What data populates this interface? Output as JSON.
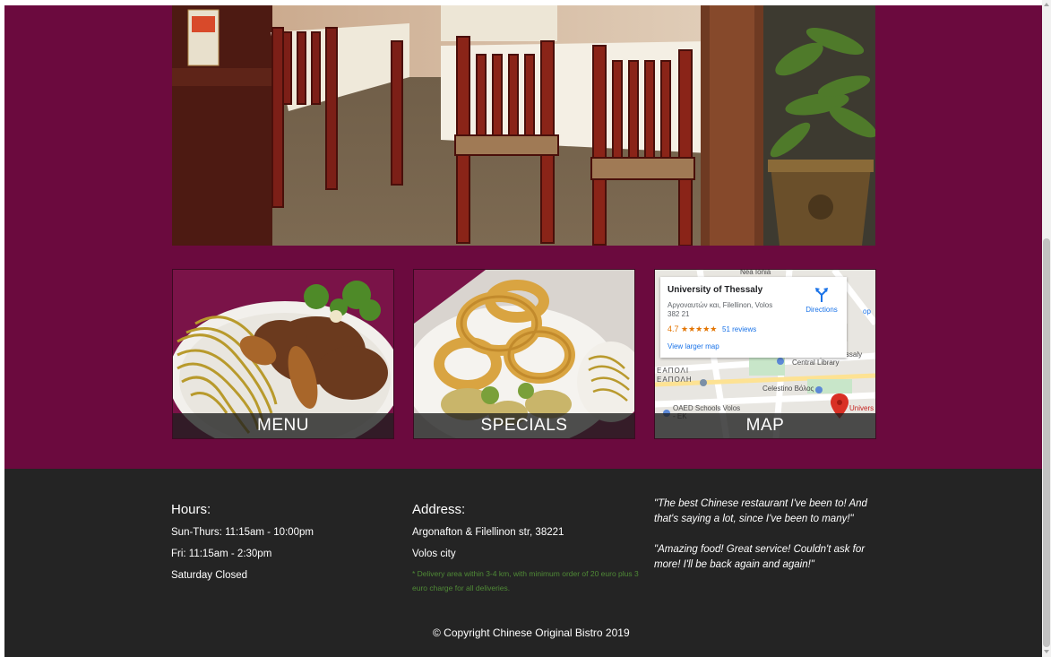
{
  "cards": [
    {
      "label": "MENU"
    },
    {
      "label": "SPECIALS"
    },
    {
      "label": "MAP"
    }
  ],
  "map": {
    "place_name": "University of Thessaly",
    "place_address": "Αργοναυτών και, Filellinon, Volos 382 21",
    "rating": "4.7 ★★★★★",
    "reviews": "51 reviews",
    "directions": "Directions",
    "larger_map": "View larger map",
    "labels": {
      "library": "University of Thessaly Central Library",
      "cafe": "Celestino Βόλος",
      "schools": "OAED Schools Volos - EK",
      "district1": "ΕΑΠΟΛΙ",
      "district2": "ΕΑΠΟΛΗ",
      "pin_label": "Univers",
      "top_label": "Nea Ionia",
      "shop": "op"
    }
  },
  "footer": {
    "hours": {
      "heading": "Hours:",
      "lines": [
        "Sun-Thurs: 11:15am - 10:00pm",
        "Fri: 11:15am - 2:30pm",
        "Saturday Closed"
      ]
    },
    "address": {
      "heading": "Address:",
      "line1": "Argonafton & Filellinon str, 38221",
      "line2": "Volos city",
      "note": "* Delivery area within 3-4 km, with minimum order of 20 euro plus 3 euro charge for all deliveries."
    },
    "quotes": [
      "\"The best Chinese restaurant I've been to! And that's saying a lot, since I've been to many!\"",
      "\"Amazing food! Great service! Couldn't ask for more! I'll be back again and again!\""
    ],
    "copyright": "© Copyright Chinese Original Bistro 2019"
  },
  "colors": {
    "band": "#6b0a3e",
    "footer": "#242424",
    "note_green": "#4f8a36",
    "map_link": "#1a73e8",
    "rating_orange": "#e37400"
  }
}
